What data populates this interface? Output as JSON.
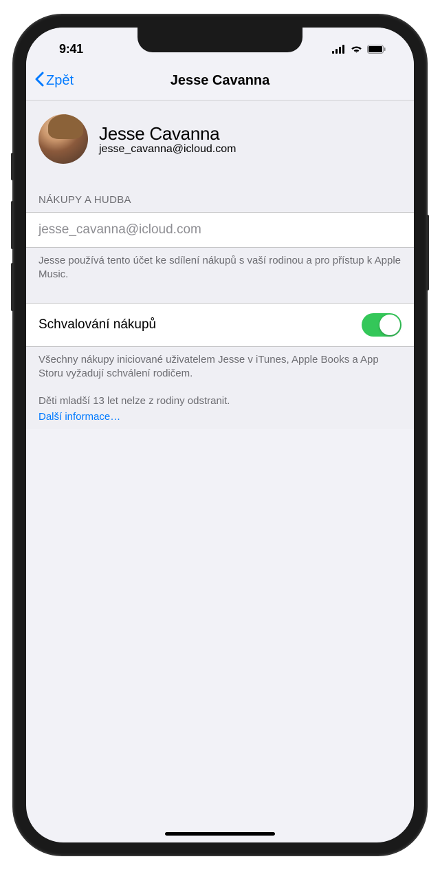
{
  "status": {
    "time": "9:41"
  },
  "nav": {
    "back": "Zpět",
    "title": "Jesse Cavanna"
  },
  "profile": {
    "name": "Jesse Cavanna",
    "email": "jesse_cavanna@icloud.com"
  },
  "section": {
    "header": "NÁKUPY A HUDBA",
    "account": "jesse_cavanna@icloud.com",
    "account_description": "Jesse používá tento účet ke sdílení nákupů s vaší rodinou a pro přístup k Apple Music.",
    "toggle_label": "Schvalování nákupů",
    "toggle_on": true,
    "toggle_description": "Všechny nákupy iniciované uživatelem Jesse v iTunes, Apple Books a App Storu vyžadují schválení rodičem.",
    "age_note": "Děti mladší 13 let nelze z rodiny odstranit.",
    "more_link": "Další informace…"
  }
}
